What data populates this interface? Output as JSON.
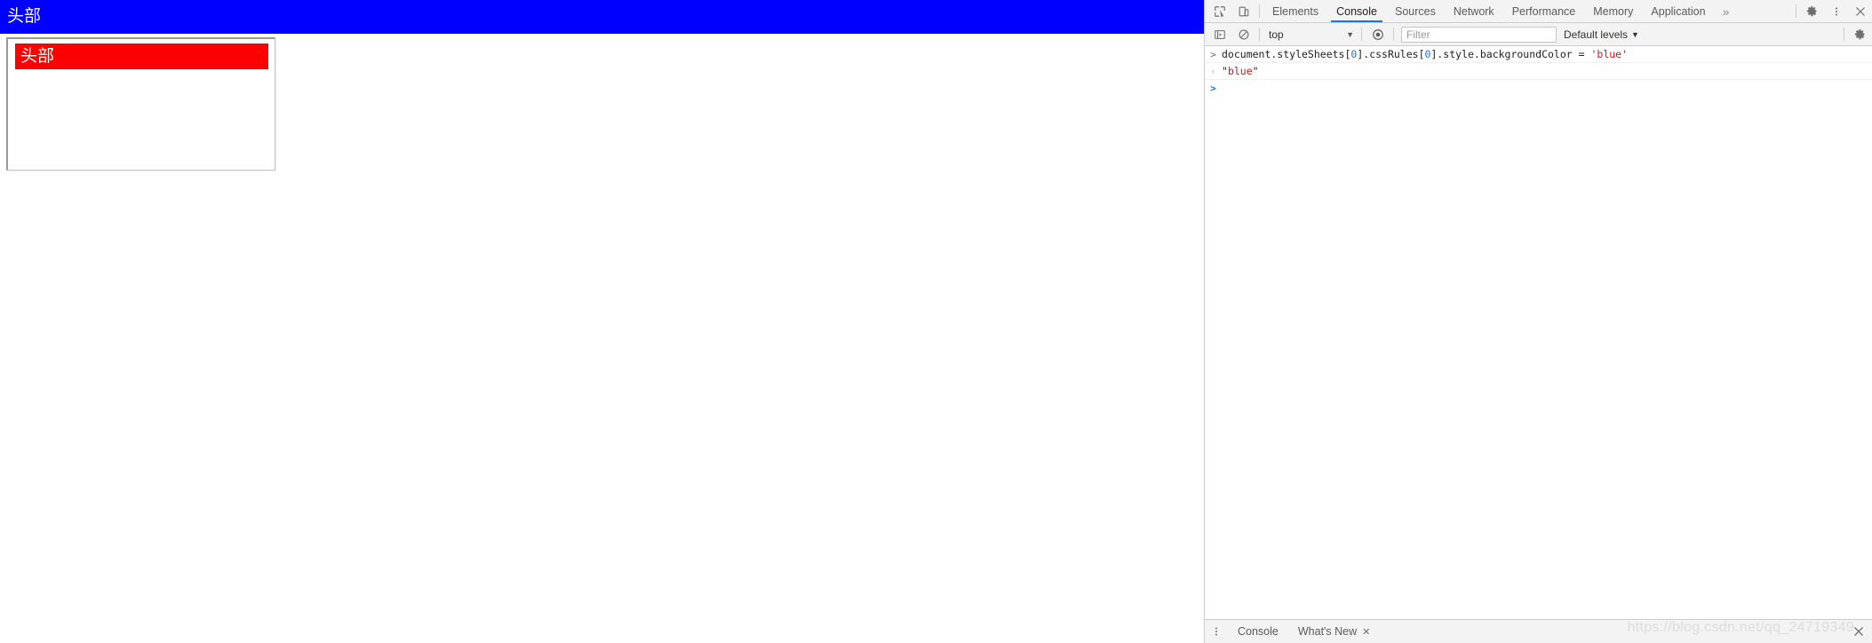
{
  "page": {
    "banner_text": "头部",
    "banner_color": "#0000ff",
    "box_header_text": "头部",
    "box_header_color": "#fe0000"
  },
  "devtools": {
    "tabs": [
      {
        "label": "Elements",
        "active": false
      },
      {
        "label": "Console",
        "active": true
      },
      {
        "label": "Sources",
        "active": false
      },
      {
        "label": "Network",
        "active": false
      },
      {
        "label": "Performance",
        "active": false
      },
      {
        "label": "Memory",
        "active": false
      },
      {
        "label": "Application",
        "active": false
      }
    ],
    "overflow_label": "»",
    "icons": {
      "inspect": "inspect-element-icon",
      "device": "device-toolbar-icon",
      "settings": "gear-icon",
      "more": "kebab-menu-icon",
      "close": "close-icon",
      "sidebar": "console-sidebar-icon",
      "clear": "clear-console-icon",
      "eye": "live-expression-icon",
      "console_settings": "console-settings-gear-icon"
    },
    "console_toolbar": {
      "context_value": "top",
      "caret": "▼",
      "filter_placeholder": "Filter",
      "filter_value": "",
      "levels_label": "Default levels",
      "levels_caret": "▼"
    },
    "console_rows": [
      {
        "kind": "input",
        "gutter": ">",
        "parts": [
          {
            "text": "document.styleSheets[",
            "cls": "tok-op"
          },
          {
            "text": "0",
            "cls": "tok-num"
          },
          {
            "text": "].cssRules[",
            "cls": "tok-op"
          },
          {
            "text": "0",
            "cls": "tok-num"
          },
          {
            "text": "].style.backgroundColor = ",
            "cls": "tok-op"
          },
          {
            "text": "'blue'",
            "cls": "tok-str"
          }
        ]
      },
      {
        "kind": "output",
        "gutter": "‹",
        "parts": [
          {
            "text": "\"",
            "cls": "tok-op"
          },
          {
            "text": "blue",
            "cls": "tok-str"
          },
          {
            "text": "\"",
            "cls": "tok-op"
          }
        ]
      },
      {
        "kind": "prompt",
        "gutter": ">",
        "parts": []
      }
    ],
    "drawer": {
      "tabs": [
        {
          "label": "Console",
          "closable": false
        },
        {
          "label": "What's New",
          "closable": true,
          "close_glyph": "✕"
        }
      ],
      "close_glyph": "✕"
    }
  },
  "watermark": {
    "text": "https://blog.csdn.net/qq_24719349"
  }
}
